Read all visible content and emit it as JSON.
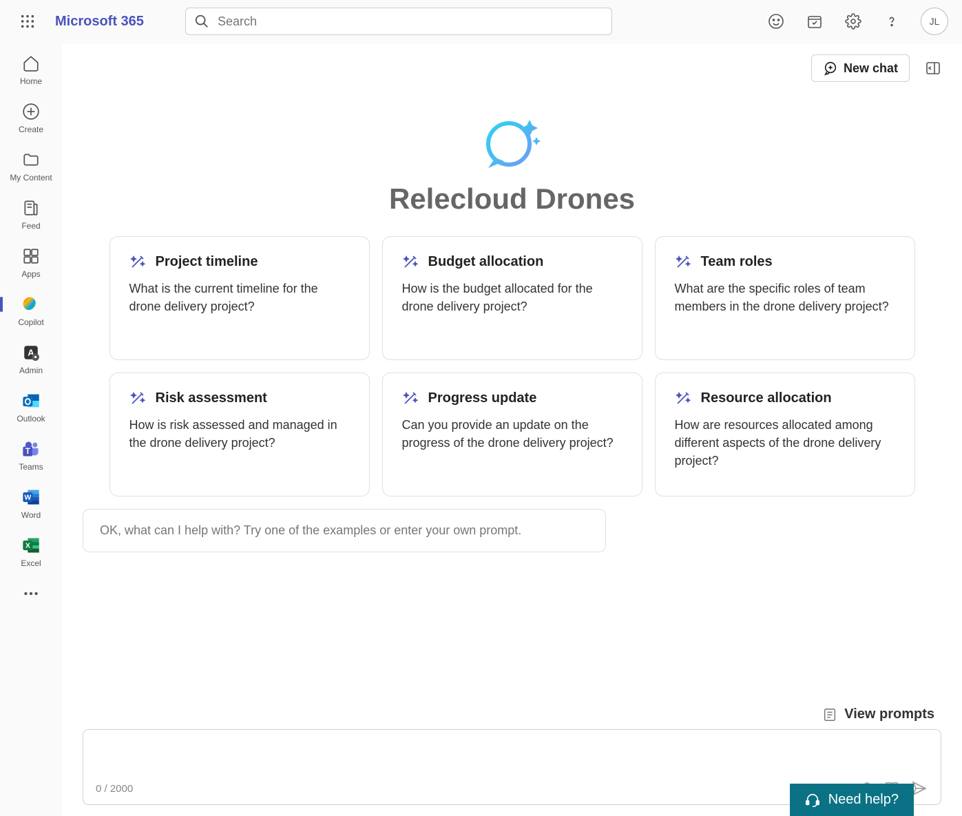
{
  "brand": "Microsoft 365",
  "search": {
    "placeholder": "Search"
  },
  "avatar": "JL",
  "sidebar": {
    "home": "Home",
    "create": "Create",
    "mycontent": "My Content",
    "feed": "Feed",
    "apps": "Apps",
    "copilot": "Copilot",
    "admin": "Admin",
    "outlook": "Outlook",
    "teams": "Teams",
    "word": "Word",
    "excel": "Excel"
  },
  "newchat": "New chat",
  "agent": {
    "title": "Relecloud Drones"
  },
  "cards": [
    {
      "title": "Project timeline",
      "body": "What is the current timeline for the drone delivery project?"
    },
    {
      "title": "Budget allocation",
      "body": "How is the budget allocated for the drone delivery project?"
    },
    {
      "title": "Team roles",
      "body": "What are the specific roles of team members in the drone delivery project?"
    },
    {
      "title": "Risk assessment",
      "body": "How is risk assessed and managed in the drone delivery project?"
    },
    {
      "title": "Progress update",
      "body": "Can you provide an update on the progress of the drone delivery project?"
    },
    {
      "title": "Resource allocation",
      "body": "How are resources allocated among different aspects of the drone delivery project?"
    }
  ],
  "hint": "OK, what can I help with? Try one of the examples or enter your own prompt.",
  "viewprompts": "View prompts",
  "counter": "0 / 2000",
  "needhelp": "Need help?"
}
